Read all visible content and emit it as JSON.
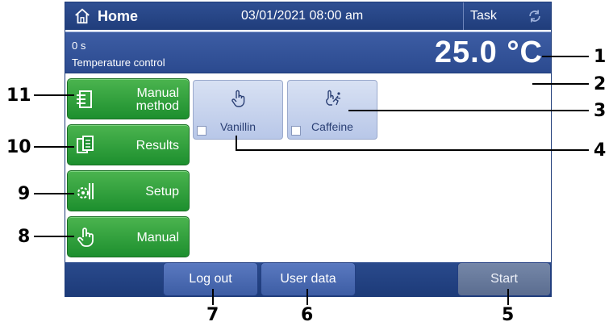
{
  "topbar": {
    "title": "Home",
    "datetime": "03/01/2021 08:00 am",
    "task_label": "Task"
  },
  "info": {
    "elapsed": "0 s",
    "label": "Temperature control",
    "temperature": "25.0 °C"
  },
  "sidebar": [
    {
      "label": "Manual\nmethod",
      "icon": "method-icon"
    },
    {
      "label": "Results",
      "icon": "results-icon"
    },
    {
      "label": "Setup",
      "icon": "setup-icon"
    },
    {
      "label": "Manual",
      "icon": "manual-hand-icon"
    }
  ],
  "shortcuts": [
    {
      "label": "Vanillin",
      "icon": "hand-pointer-icon"
    },
    {
      "label": "Caffeine",
      "icon": "hand-run-icon"
    }
  ],
  "bottombar": {
    "logout": "Log out",
    "user_data": "User data",
    "start": "Start"
  },
  "callouts": [
    "1",
    "2",
    "3",
    "4",
    "5",
    "6",
    "7",
    "8",
    "9",
    "10",
    "11"
  ],
  "colors": {
    "header_blue": "#203d7b",
    "button_green": "#1d8f2e",
    "shortcut_blue": "#b8c7e8"
  }
}
